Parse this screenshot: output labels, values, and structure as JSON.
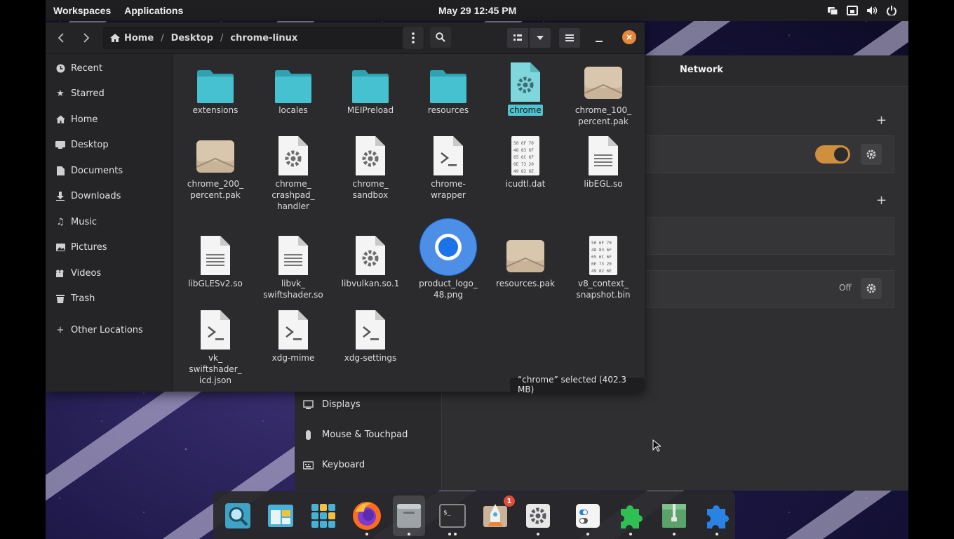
{
  "top_panel": {
    "workspaces": "Workspaces",
    "applications": "Applications",
    "clock": "May 29  12:45 PM"
  },
  "settings_window": {
    "network_title": "Network",
    "off_label": "Off",
    "toggle_on": true,
    "sidebar": [
      {
        "label": "Displays",
        "icon": "display-icon"
      },
      {
        "label": "Mouse & Touchpad",
        "icon": "mouse-icon"
      },
      {
        "label": "Keyboard",
        "icon": "keyboard-icon"
      }
    ]
  },
  "file_manager": {
    "breadcrumbs": [
      "Home",
      "Desktop",
      "chrome-linux"
    ],
    "sidebar": [
      {
        "label": "Recent",
        "icon": "clock-icon"
      },
      {
        "label": "Starred",
        "icon": "star-icon"
      },
      {
        "label": "Home",
        "icon": "home-icon"
      },
      {
        "label": "Desktop",
        "icon": "desktop-icon"
      },
      {
        "label": "Documents",
        "icon": "document-icon"
      },
      {
        "label": "Downloads",
        "icon": "download-icon"
      },
      {
        "label": "Music",
        "icon": "music-icon"
      },
      {
        "label": "Pictures",
        "icon": "picture-icon"
      },
      {
        "label": "Videos",
        "icon": "video-icon"
      },
      {
        "label": "Trash",
        "icon": "trash-icon"
      },
      {
        "label": "Other Locations",
        "icon": "plus-icon"
      }
    ],
    "files": [
      {
        "name": "extensions",
        "type": "folder"
      },
      {
        "name": "locales",
        "type": "folder"
      },
      {
        "name": "MEIPreload",
        "type": "folder"
      },
      {
        "name": "resources",
        "type": "folder"
      },
      {
        "name": "chrome",
        "type": "executable",
        "selected": true
      },
      {
        "name": "chrome_100_\npercent.pak",
        "type": "archive"
      },
      {
        "name": "chrome_200_\npercent.pak",
        "type": "archive"
      },
      {
        "name": "chrome_\ncrashpad_\nhandler",
        "type": "binary"
      },
      {
        "name": "chrome_\nsandbox",
        "type": "binary"
      },
      {
        "name": "chrome-\nwrapper",
        "type": "script"
      },
      {
        "name": "icudtl.dat",
        "type": "hex"
      },
      {
        "name": "libEGL.so",
        "type": "text"
      },
      {
        "name": "libGLESv2.so",
        "type": "text"
      },
      {
        "name": "libvk_\nswiftshader.so",
        "type": "text"
      },
      {
        "name": "libvulkan.so.1",
        "type": "binary"
      },
      {
        "name": "product_logo_\n48.png",
        "type": "image"
      },
      {
        "name": "resources.pak",
        "type": "archive"
      },
      {
        "name": "v8_context_\nsnapshot.bin",
        "type": "hex"
      },
      {
        "name": "vk_\nswiftshader_\nicd.json",
        "type": "script"
      },
      {
        "name": "xdg-mime",
        "type": "script"
      },
      {
        "name": "xdg-settings",
        "type": "script"
      }
    ],
    "status": "“chrome” selected  (402.3 MB)"
  },
  "dock": {
    "apps": [
      {
        "name": "search-app-icon",
        "dots": 0
      },
      {
        "name": "windows-app-icon",
        "dots": 0
      },
      {
        "name": "app-grid-icon",
        "dots": 0
      },
      {
        "name": "firefox-icon",
        "dots": 1
      },
      {
        "name": "files-icon",
        "dots": 1,
        "active": true
      },
      {
        "name": "terminal-icon",
        "dots": 2
      },
      {
        "name": "store-icon",
        "dots": 0,
        "badge": "1"
      },
      {
        "name": "settings-icon",
        "dots": 1
      },
      {
        "name": "tweaks-icon",
        "dots": 1
      },
      {
        "name": "extensions-green-icon",
        "dots": 1
      },
      {
        "name": "archive-manager-icon",
        "dots": 1
      },
      {
        "name": "extensions-blue-icon",
        "dots": 1
      }
    ]
  }
}
